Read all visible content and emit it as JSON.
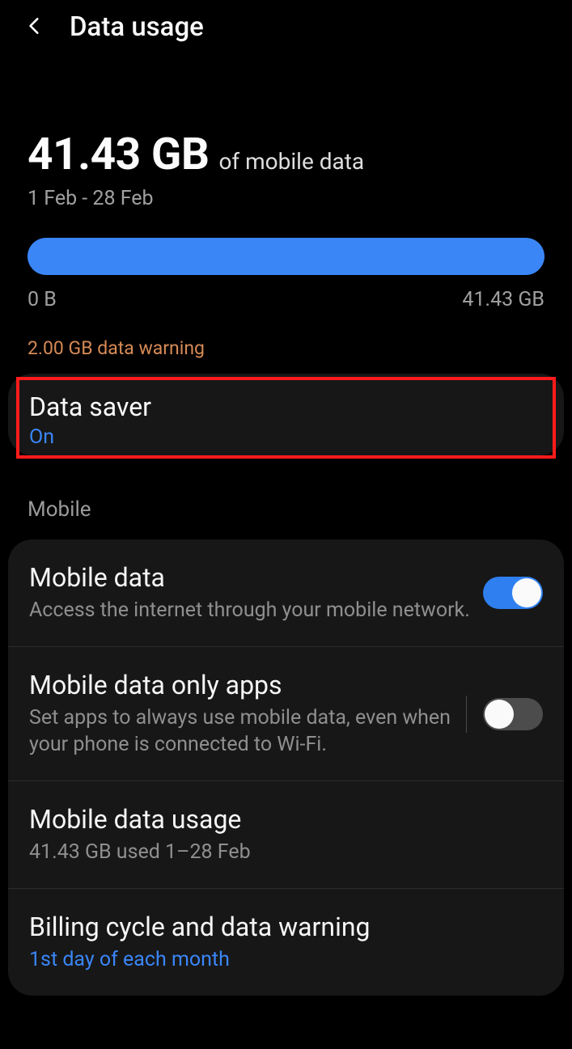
{
  "header": {
    "title": "Data usage"
  },
  "usage": {
    "amount": "41.43 GB",
    "suffix": "of mobile data",
    "period": "1 Feb - 28 Feb",
    "min_label": "0 B",
    "max_label": "41.43 GB",
    "warning": "2.00 GB data warning"
  },
  "data_saver": {
    "title": "Data saver",
    "status": "On"
  },
  "section": {
    "mobile_label": "Mobile"
  },
  "mobile": {
    "data": {
      "title": "Mobile data",
      "sub": "Access the internet through your mobile network.",
      "toggle_on": true
    },
    "only_apps": {
      "title": "Mobile data only apps",
      "sub": "Set apps to always use mobile data, even when your phone is connected to Wi-Fi.",
      "toggle_on": false
    },
    "usage": {
      "title": "Mobile data usage",
      "sub": "41.43 GB used 1–28 Feb"
    },
    "billing": {
      "title": "Billing cycle and data warning",
      "sub": "1st day of each month"
    }
  }
}
